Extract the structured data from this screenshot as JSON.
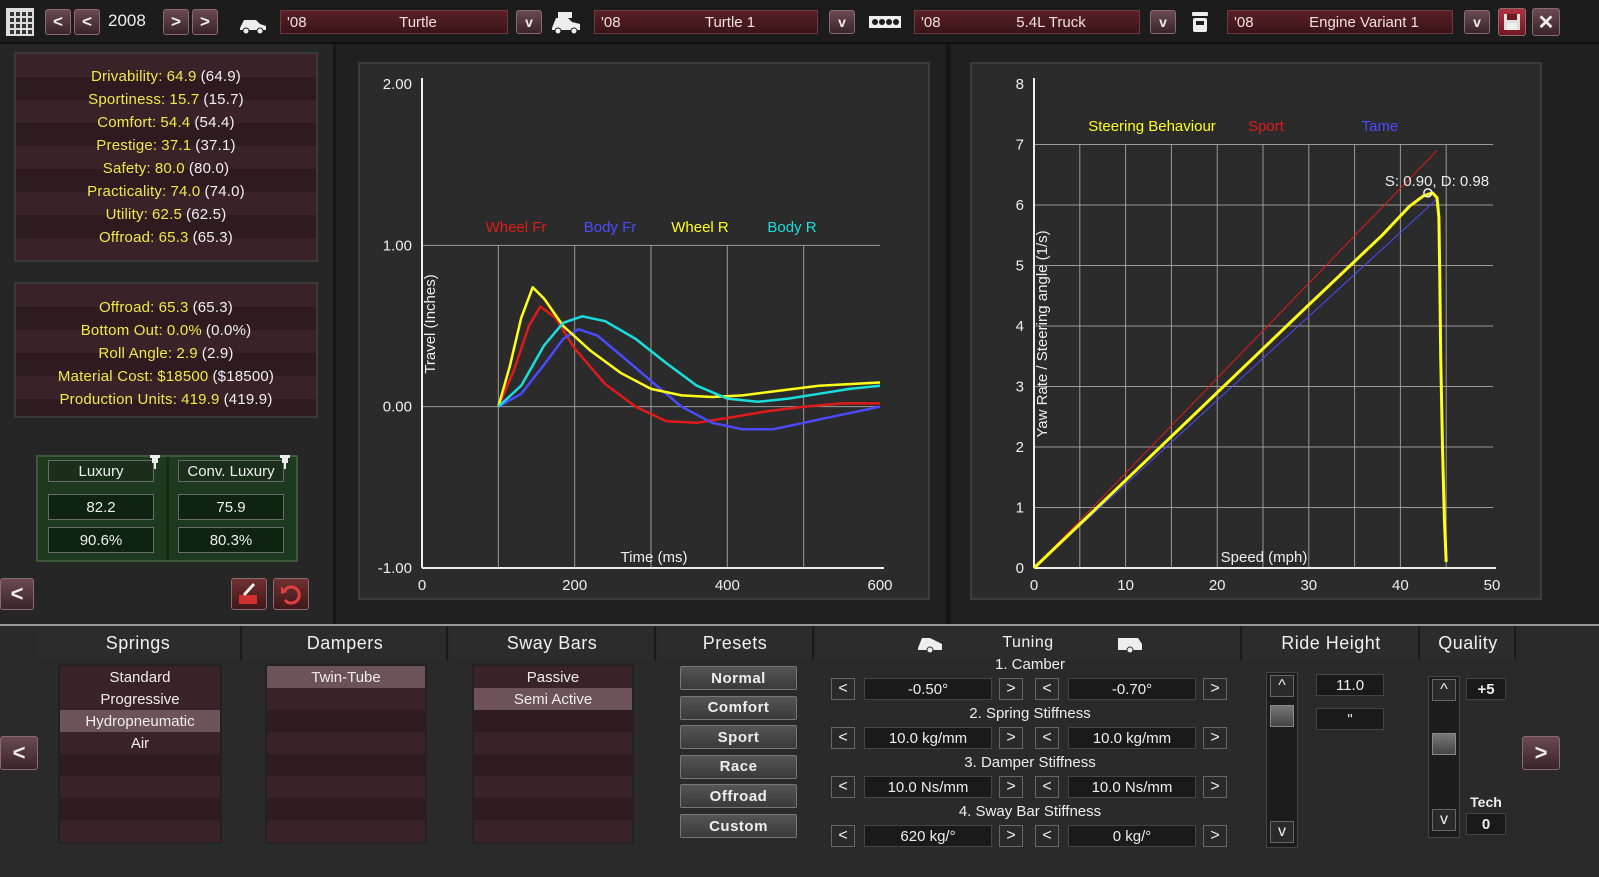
{
  "topbar": {
    "year": "2008",
    "model": {
      "year": "'08",
      "name": "Turtle"
    },
    "trim": {
      "year": "'08",
      "name": "Turtle 1"
    },
    "engine": {
      "year": "'08",
      "name": "5.4L Truck"
    },
    "variant": {
      "year": "'08",
      "name": "Engine Variant 1"
    },
    "dropdown_glyph": "v",
    "prev_glyph": "<",
    "next_glyph": ">"
  },
  "stats1": [
    {
      "label": "Drivability:",
      "value": "64.9",
      "paren": "(64.9)"
    },
    {
      "label": "Sportiness:",
      "value": "15.7",
      "paren": "(15.7)"
    },
    {
      "label": "Comfort:",
      "value": "54.4",
      "paren": "(54.4)"
    },
    {
      "label": "Prestige:",
      "value": "37.1",
      "paren": "(37.1)"
    },
    {
      "label": "Safety:",
      "value": "80.0",
      "paren": "(80.0)"
    },
    {
      "label": "Practicality:",
      "value": "74.0",
      "paren": "(74.0)"
    },
    {
      "label": "Utility:",
      "value": "62.5",
      "paren": "(62.5)"
    },
    {
      "label": "Offroad:",
      "value": "65.3",
      "paren": "(65.3)"
    }
  ],
  "stats2": [
    {
      "label": "Offroad:",
      "value": "65.3",
      "paren": "(65.3)"
    },
    {
      "label": "Bottom Out:",
      "value": "0.0%",
      "paren": "(0.0%)"
    },
    {
      "label": "Roll Angle:",
      "value": "2.9",
      "paren": "(2.9)"
    },
    {
      "label": "Material Cost:",
      "value": "$18500",
      "paren": "($18500)"
    },
    {
      "label": "Production Units:",
      "value": "419.9",
      "paren": "(419.9)"
    }
  ],
  "demographics": [
    {
      "name": "Luxury",
      "score": "82.2",
      "pct": "90.6%"
    },
    {
      "name": "Conv. Luxury",
      "score": "75.9",
      "pct": "80.3%"
    }
  ],
  "chart_data": [
    {
      "type": "line",
      "xlabel": "Time (ms)",
      "ylabel": "Travel (Inches)",
      "xlim": [
        0,
        600
      ],
      "ylim": [
        -1.0,
        2.0
      ],
      "x_ticks": [
        "0",
        "200",
        "400",
        "600"
      ],
      "y_ticks": [
        "2.00",
        "1.00",
        "0.00",
        "-1.00"
      ],
      "legend_position": "top",
      "series": [
        {
          "name": "Wheel Fr",
          "color": "#e01a1a",
          "points": [
            [
              100,
              0
            ],
            [
              120,
              0.22
            ],
            [
              140,
              0.5
            ],
            [
              155,
              0.62
            ],
            [
              175,
              0.55
            ],
            [
              200,
              0.36
            ],
            [
              240,
              0.14
            ],
            [
              280,
              0.0
            ],
            [
              320,
              -0.09
            ],
            [
              360,
              -0.1
            ],
            [
              400,
              -0.07
            ],
            [
              450,
              -0.03
            ],
            [
              500,
              0.0
            ],
            [
              550,
              0.02
            ],
            [
              600,
              0.02
            ]
          ]
        },
        {
          "name": "Body Fr",
          "color": "#4a4aff",
          "points": [
            [
              100,
              0
            ],
            [
              130,
              0.08
            ],
            [
              160,
              0.26
            ],
            [
              185,
              0.42
            ],
            [
              205,
              0.48
            ],
            [
              230,
              0.44
            ],
            [
              260,
              0.32
            ],
            [
              300,
              0.16
            ],
            [
              340,
              0.0
            ],
            [
              380,
              -0.1
            ],
            [
              420,
              -0.14
            ],
            [
              460,
              -0.14
            ],
            [
              500,
              -0.1
            ],
            [
              550,
              -0.05
            ],
            [
              600,
              0.0
            ]
          ]
        },
        {
          "name": "Wheel R",
          "color": "#ffff1a",
          "points": [
            [
              100,
              0
            ],
            [
              115,
              0.25
            ],
            [
              130,
              0.55
            ],
            [
              145,
              0.74
            ],
            [
              160,
              0.67
            ],
            [
              185,
              0.5
            ],
            [
              220,
              0.35
            ],
            [
              260,
              0.21
            ],
            [
              300,
              0.11
            ],
            [
              340,
              0.07
            ],
            [
              380,
              0.06
            ],
            [
              420,
              0.07
            ],
            [
              470,
              0.1
            ],
            [
              520,
              0.13
            ],
            [
              560,
              0.14
            ],
            [
              600,
              0.15
            ]
          ]
        },
        {
          "name": "Body R",
          "color": "#1adede",
          "points": [
            [
              100,
              0
            ],
            [
              130,
              0.13
            ],
            [
              160,
              0.38
            ],
            [
              185,
              0.52
            ],
            [
              210,
              0.56
            ],
            [
              240,
              0.53
            ],
            [
              280,
              0.42
            ],
            [
              320,
              0.27
            ],
            [
              360,
              0.13
            ],
            [
              400,
              0.05
            ],
            [
              440,
              0.03
            ],
            [
              480,
              0.05
            ],
            [
              520,
              0.08
            ],
            [
              560,
              0.11
            ],
            [
              600,
              0.13
            ]
          ]
        }
      ]
    },
    {
      "type": "line",
      "title": "Steering Behaviour",
      "xlabel": "Speed (mph)",
      "ylabel": "Yaw Rate / Steering angle (1/s)",
      "xlim": [
        0,
        50
      ],
      "ylim": [
        0,
        8
      ],
      "x_ticks": [
        "0",
        "10",
        "20",
        "30",
        "40",
        "50"
      ],
      "y_ticks": [
        "8",
        "7",
        "6",
        "5",
        "4",
        "3",
        "2",
        "1",
        "0"
      ],
      "annotation": "S: 0.90, D: 0.98",
      "legend_position": "top",
      "series": [
        {
          "name": "Sport",
          "color": "#e01a1a",
          "points": [
            [
              0,
              0
            ],
            [
              44,
              6.9
            ]
          ]
        },
        {
          "name": "Tame",
          "color": "#4a4aff",
          "points": [
            [
              0,
              0
            ],
            [
              44,
              6.1
            ]
          ]
        },
        {
          "name": "Steering Behaviour",
          "color": "#ffff1a",
          "points": [
            [
              0,
              0
            ],
            [
              10,
              1.45
            ],
            [
              20,
              2.9
            ],
            [
              30,
              4.35
            ],
            [
              38,
              5.5
            ],
            [
              41,
              5.98
            ],
            [
              42.5,
              6.15
            ],
            [
              43.5,
              6.2
            ],
            [
              44,
              6.12
            ],
            [
              44.2,
              5.8
            ],
            [
              44.3,
              4.8
            ],
            [
              44.4,
              3.5
            ],
            [
              44.6,
              2.0
            ],
            [
              44.8,
              0.8
            ],
            [
              45,
              0.1
            ]
          ]
        }
      ]
    }
  ],
  "bottom": {
    "springs_title": "Springs",
    "springs": [
      "Standard",
      "Progressive",
      "Hydropneumatic",
      "Air"
    ],
    "springs_selected": 2,
    "dampers_title": "Dampers",
    "dampers": [
      "Twin-Tube"
    ],
    "dampers_selected": 0,
    "sway_title": "Sway Bars",
    "sway": [
      "Passive",
      "Semi Active"
    ],
    "sway_selected": 1,
    "presets_title": "Presets",
    "presets": [
      "Normal",
      "Comfort",
      "Sport",
      "Race",
      "Offroad",
      "Custom"
    ],
    "tuning_title": "Tuning",
    "tuning": [
      {
        "label": "1. Camber",
        "front": "-0.50°",
        "rear": "-0.70°"
      },
      {
        "label": "2. Spring Stiffness",
        "front": "10.0 kg/mm",
        "rear": "10.0 kg/mm"
      },
      {
        "label": "3. Damper Stiffness",
        "front": "10.0 Ns/mm",
        "rear": "10.0 Ns/mm"
      },
      {
        "label": "4. Sway Bar Stiffness",
        "front": "620 kg/°",
        "rear": "0 kg/°"
      }
    ],
    "ride_title": "Ride Height",
    "ride_value": "11.0",
    "ride_unit": "\"",
    "quality_title": "Quality",
    "quality_value": "+5",
    "tech_label": "Tech",
    "tech_value": "0"
  }
}
